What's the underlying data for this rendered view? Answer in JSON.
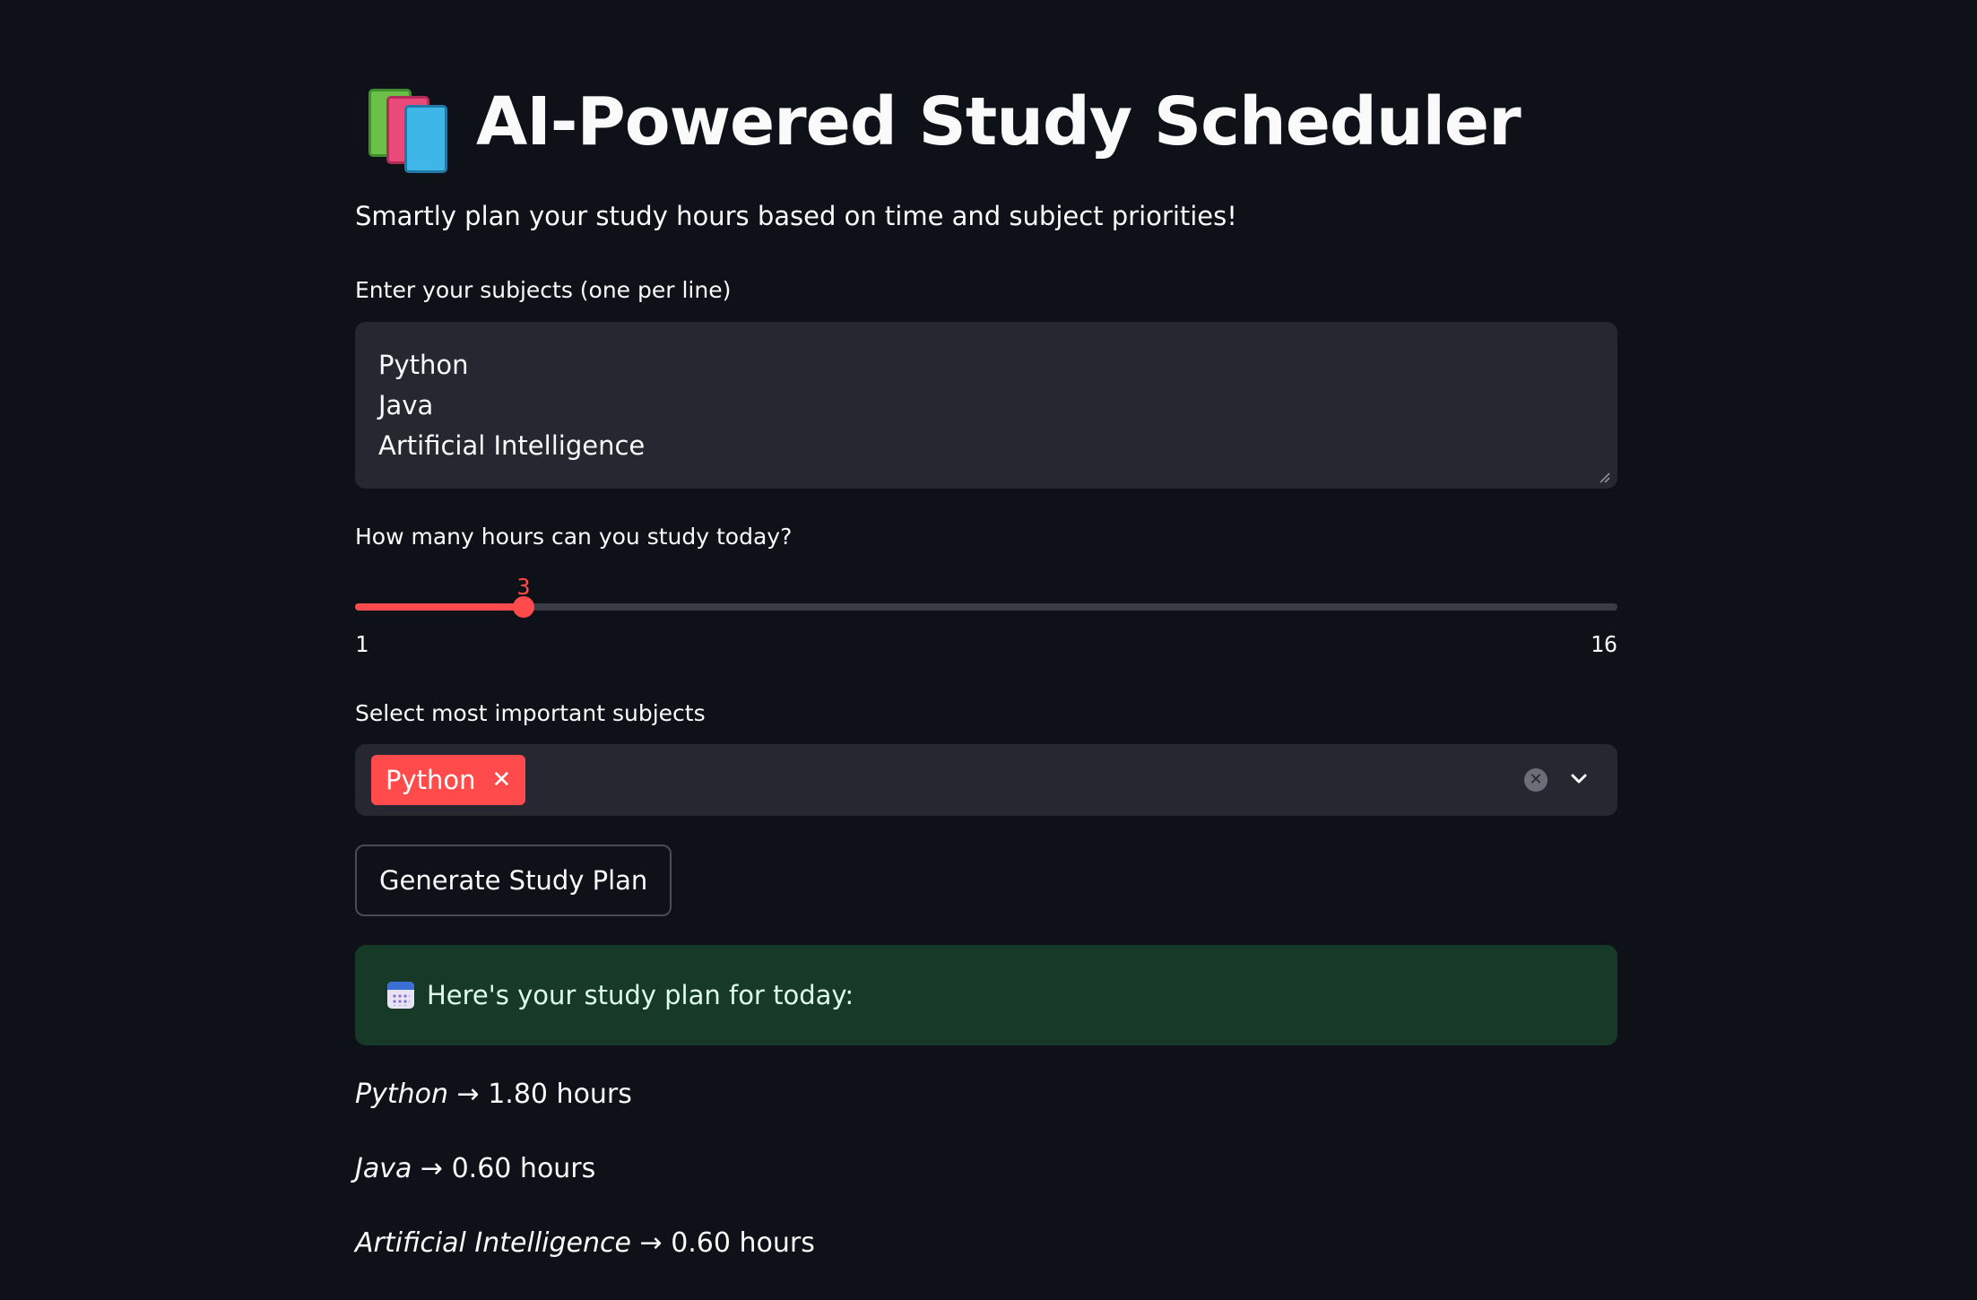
{
  "header": {
    "title": "AI-Powered Study Scheduler",
    "title_icon": "books-icon",
    "subtitle": "Smartly plan your study hours based on time and subject priorities!"
  },
  "subjects_input": {
    "label": "Enter your subjects (one per line)",
    "lines": [
      "Python",
      "Java",
      "Artificial Intelligence"
    ]
  },
  "hours_slider": {
    "label": "How many hours can you study today?",
    "value": "3",
    "min": "1",
    "max": "16",
    "fraction": 0.1333
  },
  "priority_select": {
    "label": "Select most important subjects",
    "selected": [
      "Python"
    ]
  },
  "generate_button": {
    "label": "Generate Study Plan"
  },
  "result": {
    "message": "Here's your study plan for today:",
    "icon": "calendar-icon",
    "plan": [
      {
        "subject": "Python",
        "arrow": " → ",
        "hours": "1.80 hours"
      },
      {
        "subject": "Java",
        "arrow": " → ",
        "hours": "0.60 hours"
      },
      {
        "subject": "Artificial Intelligence",
        "arrow": " → ",
        "hours": "0.60 hours"
      }
    ]
  },
  "colors": {
    "background": "#0e1117",
    "accent": "#ff4b4b",
    "input_bg": "#262730",
    "success_bg": "#173928"
  }
}
